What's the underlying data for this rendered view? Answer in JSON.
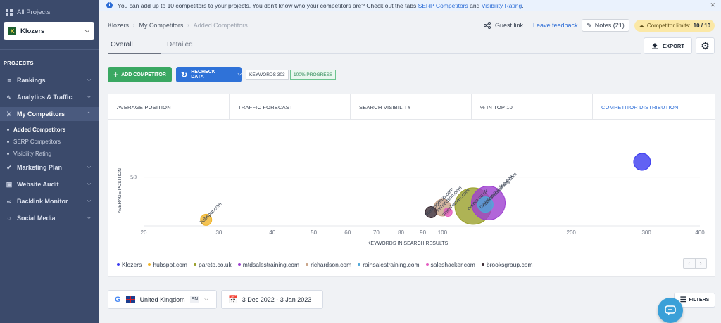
{
  "sidebar": {
    "all_projects": "All Projects",
    "project_name": "Klozers",
    "project_logo": "K",
    "section": "PROJECTS",
    "items": [
      {
        "label": "Rankings",
        "icon": "rankings-icon"
      },
      {
        "label": "Analytics & Traffic",
        "icon": "analytics-icon"
      },
      {
        "label": "My Competitors",
        "icon": "competitors-icon"
      },
      {
        "label": "Marketing Plan",
        "icon": "marketing-plan-icon"
      },
      {
        "label": "Website Audit",
        "icon": "website-audit-icon"
      },
      {
        "label": "Backlink Monitor",
        "icon": "backlink-icon"
      },
      {
        "label": "Social Media",
        "icon": "social-media-icon"
      }
    ],
    "subitems": [
      "Added Competitors",
      "SERP Competitors",
      "Visibility Rating"
    ]
  },
  "notice": {
    "text": "You can add up to 10 competitors to your projects. You don't know who your competitors are? Check out the tabs",
    "link1": "SERP Competitors",
    "and": "and",
    "link2": "Visibility Rating",
    "period": "."
  },
  "breadcrumb": [
    "Klozers",
    "My Competitors",
    "Added Competitors"
  ],
  "header": {
    "guest_link": "Guest link",
    "leave_feedback": "Leave feedback",
    "notes": "Notes (21)",
    "limits_label": "Competitor limits:",
    "limits_value": "10 / 10"
  },
  "tabs": {
    "overall": "Overall",
    "detailed": "Detailed"
  },
  "toolbar": {
    "export": "EXPORT",
    "add_competitor": "ADD COMPETITOR",
    "recheck_data": "RECHECK DATA",
    "keywords": "KEYWORDS 303",
    "progress": "100% PROGRESS"
  },
  "metric_tabs": [
    "AVERAGE POSITION",
    "TRAFFIC FORECAST",
    "SEARCH VISIBILITY",
    "% IN TOP 10",
    "COMPETITOR DISTRIBUTION"
  ],
  "chart_data": {
    "type": "scatter",
    "xlabel": "KEYWORDS IN SEARCH RESULTS",
    "ylabel": "AVERAGE POSITION",
    "x_ticks": [
      20,
      30,
      40,
      50,
      60,
      70,
      80,
      90,
      100,
      200,
      300,
      400
    ],
    "x_scale": "log",
    "y_ticks": [
      50
    ],
    "xlim": [
      20,
      400
    ],
    "ylim": [
      82,
      22
    ],
    "grid": true,
    "legend_position": "bottom-left",
    "series": [
      {
        "name": "Klozers",
        "color": "#3b3bf0",
        "x": 293,
        "y": 40,
        "size": 12
      },
      {
        "name": "hubspot.com",
        "color": "#f0b429",
        "x": 28,
        "y": 78,
        "size": 8,
        "label": "hubspot.com"
      },
      {
        "name": "pareto.co.uk",
        "color": "#9aa02a",
        "x": 118,
        "y": 69,
        "size": 26,
        "label": "pareto.co.uk"
      },
      {
        "name": "mtdsalestraining.com",
        "color": "#9d3fd0",
        "x": 128,
        "y": 67,
        "size": 24,
        "label": "mtdsalestraining.com"
      },
      {
        "name": "richardson.com",
        "color": "#c9a488",
        "x": 100,
        "y": 70,
        "size": 12,
        "label": "richardson.com"
      },
      {
        "name": "rainsalestraining.com",
        "color": "#4fa8d8",
        "x": 126,
        "y": 68,
        "size": 11,
        "label": "rainsalestraining.com"
      },
      {
        "name": "saleshacker.com",
        "color": "#e45cc0",
        "x": 103,
        "y": 73,
        "size": 6,
        "label": "saleshacker.com"
      },
      {
        "name": "brooksgroup.com",
        "color": "#3a2a33",
        "x": 94,
        "y": 73,
        "size": 8,
        "label": "brooksgroup.com"
      }
    ]
  },
  "filters": {
    "search_engine": "G",
    "country": "United Kingdom",
    "language": "EN",
    "date_range": "3 Dec 2022 - 3 Jan 2023",
    "filters_label": "FILTERS"
  }
}
